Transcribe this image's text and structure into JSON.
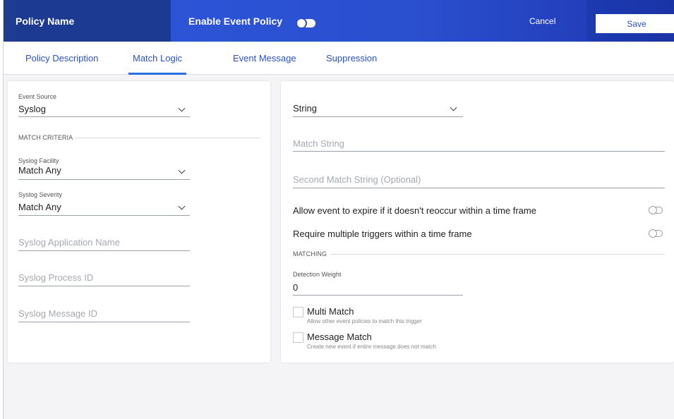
{
  "header": {
    "policy_name": "Policy Name",
    "enable_label": "Enable Event Policy",
    "enable_toggle_on": true,
    "cancel_label": "Cancel",
    "save_label": "Save"
  },
  "tabs": [
    {
      "label": "Policy Description",
      "active": false
    },
    {
      "label": "Match Logic",
      "active": true
    },
    {
      "label": "Event Message",
      "active": false
    },
    {
      "label": "Suppression",
      "active": false
    }
  ],
  "left": {
    "event_source_label": "Event Source",
    "event_source_value": "Syslog",
    "match_criteria_title": "MATCH CRITERIA",
    "facility_label": "Syslog Facility",
    "facility_value": "Match Any",
    "severity_label": "Syslog Severity",
    "severity_value": "Match Any",
    "app_name_placeholder": "Syslog Application Name",
    "process_id_placeholder": "Syslog Process ID",
    "message_id_placeholder": "Syslog Message ID"
  },
  "right": {
    "match_type_value": "String",
    "match_string_placeholder": "Match String",
    "second_match_placeholder": "Second Match String (Optional)",
    "expire_label": "Allow event to expire if it doesn't reoccur within a time frame",
    "multiple_triggers_label": "Require multiple triggers within a time frame",
    "matching_title": "MATCHING",
    "detection_weight_label": "Detection Weight",
    "detection_weight_value": "0",
    "multi_match_label": "Multi Match",
    "multi_match_desc": "Allow other event policies to match this trigger",
    "message_match_label": "Message Match",
    "message_match_desc": "Create new event if entire message does not match"
  },
  "colors": {
    "header_dark": "#1c3a91",
    "header_blue": "#2a4fcf",
    "tab_text": "#2a52c9",
    "tab_underline": "#2a6fe0"
  }
}
